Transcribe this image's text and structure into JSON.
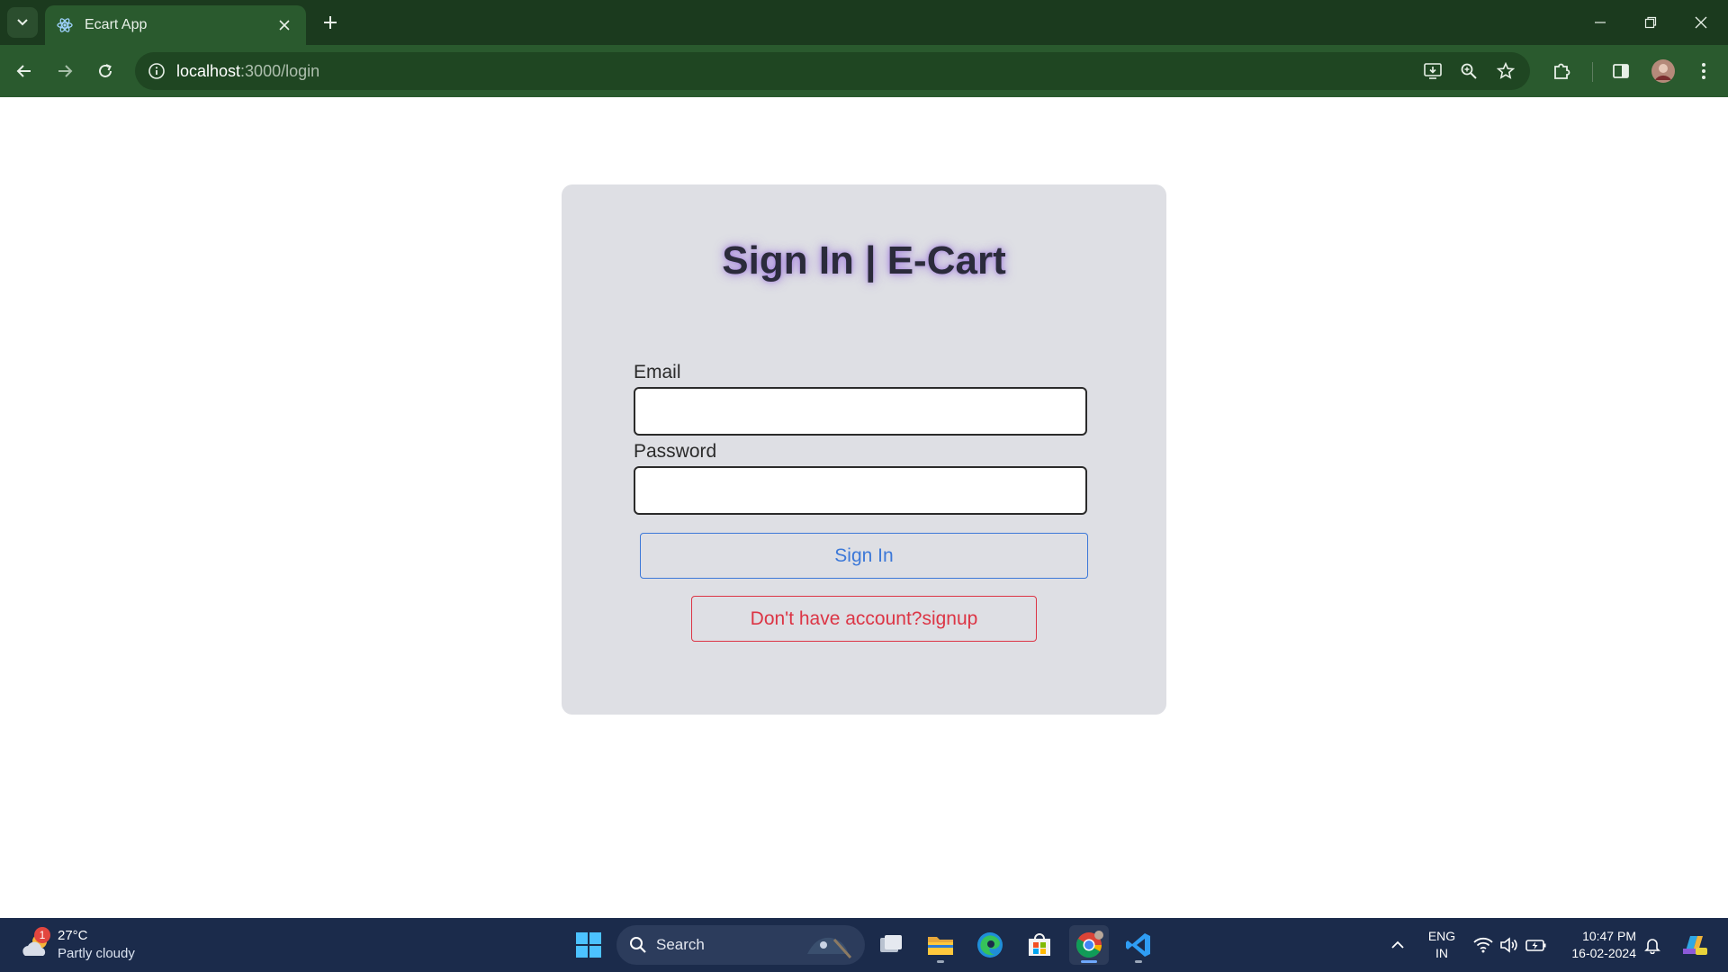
{
  "browser": {
    "tab_title": "Ecart App",
    "url_host": "localhost",
    "url_path": ":3000/login"
  },
  "login": {
    "title": "Sign In | E-Cart",
    "email_label": "Email",
    "email_value": "",
    "password_label": "Password",
    "password_value": "",
    "signin_label": "Sign In",
    "signup_label": "Don't have account?signup"
  },
  "taskbar": {
    "weather_temp": "27°C",
    "weather_condition": "Partly cloudy",
    "weather_badge": "1",
    "search_label": "Search",
    "lang_line1": "ENG",
    "lang_line2": "IN",
    "time": "10:47 PM",
    "date": "16-02-2024"
  },
  "colors": {
    "tabbar_bg": "#1b3a1e",
    "toolbar_bg": "#2a5a2e",
    "card_bg": "#dedfe4",
    "signin_accent": "#3c78d8",
    "signup_accent": "#dc3545",
    "taskbar_bg": "#1b2b4b"
  },
  "icons": {
    "tab_dropdown": "chevron-down-icon",
    "favicon": "react-icon",
    "tab_close": "close-icon",
    "new_tab": "plus-icon",
    "back": "arrow-left-icon",
    "forward": "arrow-right-icon",
    "reload": "reload-icon",
    "site_info": "info-icon",
    "install": "install-app-icon",
    "zoom": "zoom-icon",
    "bookmark": "star-icon",
    "extensions": "puzzle-icon",
    "side_panel": "side-panel-icon",
    "profile": "avatar",
    "menu": "kebab-menu-icon"
  }
}
